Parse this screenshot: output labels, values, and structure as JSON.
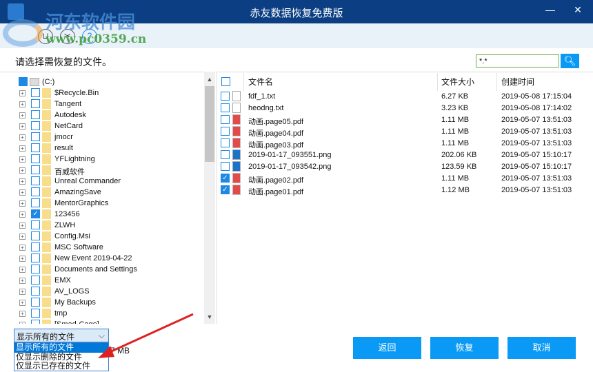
{
  "window": {
    "title": "赤友数据恢复免费版",
    "minimize": "—",
    "close": "✕"
  },
  "watermark": {
    "name": "河东软件园",
    "url": "www.pc0359.cn"
  },
  "toolbar": [
    {
      "icon": "cart-icon",
      "glyph": "⊔"
    },
    {
      "icon": "tools-icon",
      "glyph": "✂"
    },
    {
      "icon": "help-icon",
      "glyph": "?"
    }
  ],
  "prompt": "请选择需恢复的文件。",
  "search": {
    "value": "*.*",
    "icon": "search-icon"
  },
  "tree": {
    "root": "(C:)",
    "items": [
      {
        "label": "$Recycle.Bin",
        "checked": false
      },
      {
        "label": "Tangent",
        "checked": false
      },
      {
        "label": "Autodesk",
        "checked": false
      },
      {
        "label": "NetCard",
        "checked": false
      },
      {
        "label": "jmocr",
        "checked": false
      },
      {
        "label": "result",
        "checked": false
      },
      {
        "label": "YFLightning",
        "checked": false
      },
      {
        "label": "百威软件",
        "checked": false
      },
      {
        "label": "Unreal Commander",
        "checked": false
      },
      {
        "label": "AmazingSave",
        "checked": false
      },
      {
        "label": "MentorGraphics",
        "checked": false
      },
      {
        "label": "123456",
        "checked": true
      },
      {
        "label": "ZLWH",
        "checked": false
      },
      {
        "label": "Config.Msi",
        "checked": false
      },
      {
        "label": "MSC Software",
        "checked": false
      },
      {
        "label": "New Event 2019-04-22",
        "checked": false
      },
      {
        "label": "Documents and Settings",
        "checked": false
      },
      {
        "label": "EMX",
        "checked": false
      },
      {
        "label": "AV_LOGS",
        "checked": false
      },
      {
        "label": "My Backups",
        "checked": false
      },
      {
        "label": "tmp",
        "checked": false
      },
      {
        "label": "[Smad-Cage]",
        "checked": false
      }
    ]
  },
  "files": {
    "headers": {
      "name": "文件名",
      "size": "文件大小",
      "time": "创建时间"
    },
    "rows": [
      {
        "name": "fdf_1.txt",
        "size": "6.27 KB",
        "time": "2019-05-08 17:15:04",
        "type": "txt",
        "checked": false
      },
      {
        "name": "heodng.txt",
        "size": "3.23 KB",
        "time": "2019-05-08 17:14:02",
        "type": "txt",
        "checked": false
      },
      {
        "name": "动画.page05.pdf",
        "size": "1.11 MB",
        "time": "2019-05-07 13:51:03",
        "type": "pdf",
        "checked": false
      },
      {
        "name": "动画.page04.pdf",
        "size": "1.11 MB",
        "time": "2019-05-07 13:51:03",
        "type": "pdf",
        "checked": false
      },
      {
        "name": "动画.page03.pdf",
        "size": "1.11 MB",
        "time": "2019-05-07 13:51:03",
        "type": "pdf",
        "checked": false
      },
      {
        "name": "2019-01-17_093551.png",
        "size": "202.06 KB",
        "time": "2019-05-07 15:10:17",
        "type": "png",
        "checked": false
      },
      {
        "name": "2019-01-17_093542.png",
        "size": "123.59 KB",
        "time": "2019-05-07 15:10:17",
        "type": "png",
        "checked": false
      },
      {
        "name": "动画.page02.pdf",
        "size": "1.11 MB",
        "time": "2019-05-07 13:51:03",
        "type": "pdf",
        "checked": true
      },
      {
        "name": "动画.page01.pdf",
        "size": "1.12 MB",
        "time": "2019-05-07 13:51:03",
        "type": "pdf",
        "checked": true
      }
    ]
  },
  "filter": {
    "selected": "显示所有的文件",
    "options": [
      "显示所有的文件",
      "仅显示删除的文件",
      "仅显示已存在的文件"
    ]
  },
  "size_info": "7 MB",
  "buttons": {
    "back": "返回",
    "recover": "恢复",
    "cancel": "取消"
  },
  "colors": {
    "titlebar": "#0b3e82",
    "accent": "#0a9af5",
    "annotation_arrow": "#e02020"
  }
}
